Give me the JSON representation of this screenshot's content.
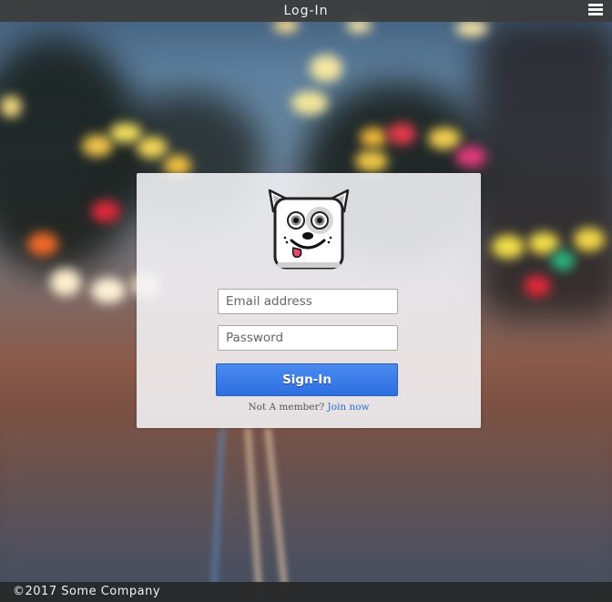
{
  "header": {
    "title": "Log-In",
    "menu_icon": "hamburger-menu-icon"
  },
  "login": {
    "logo_icon": "dog-mascot-logo",
    "email_placeholder": "Email address",
    "email_value": "",
    "password_placeholder": "Password",
    "password_value": "",
    "signin_label": "Sign-In",
    "member_prompt": "Not A member?",
    "join_label": "Join now"
  },
  "footer": {
    "copyright": "©2017 Some Company"
  },
  "colors": {
    "accent": "#3579ea",
    "link": "#2a6fd6",
    "bar": "#3c3c3c"
  }
}
